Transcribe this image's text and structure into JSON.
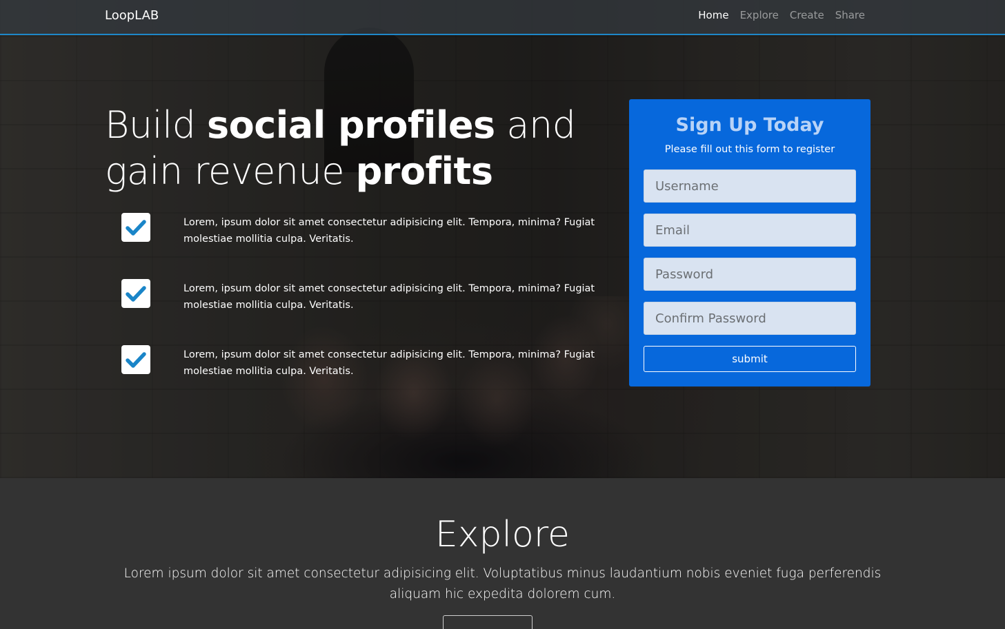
{
  "navbar": {
    "brand": "LoopLAB",
    "links": [
      "Home",
      "Explore",
      "Create",
      "Share"
    ],
    "active": "Home",
    "accent_color": "#1e88c9"
  },
  "hero": {
    "headline_part1": "Build ",
    "headline_bold1": "social profiles",
    "headline_part2": " and gain revenue ",
    "headline_bold2": "profits",
    "features": [
      {
        "icon": "check-icon",
        "text": "Lorem, ipsum dolor sit amet consectetur adipisicing elit. Tempora, minima? Fugiat molestiae mollitia culpa. Veritatis."
      },
      {
        "icon": "check-icon",
        "text": "Lorem, ipsum dolor sit amet consectetur adipisicing elit. Tempora, minima? Fugiat molestiae mollitia culpa. Veritatis."
      },
      {
        "icon": "check-icon",
        "text": "Lorem, ipsum dolor sit amet consectetur adipisicing elit. Tempora, minima? Fugiat molestiae mollitia culpa. Veritatis."
      }
    ],
    "check_color": "#1a85c8"
  },
  "signup": {
    "title": "Sign Up Today",
    "subtitle": "Please fill out this form to register",
    "fields": {
      "username_placeholder": "Username",
      "email_placeholder": "Email",
      "password_placeholder": "Password",
      "confirm_placeholder": "Confirm Password"
    },
    "submit_label": "submit",
    "card_color": "#056eeb"
  },
  "explore": {
    "title": "Explore",
    "text": "Lorem ipsum dolor sit amet consectetur adipisicing elit. Voluptatibus minus laudantium nobis eveniet fuga perferendis aliquam hic expedita dolorem cum."
  }
}
